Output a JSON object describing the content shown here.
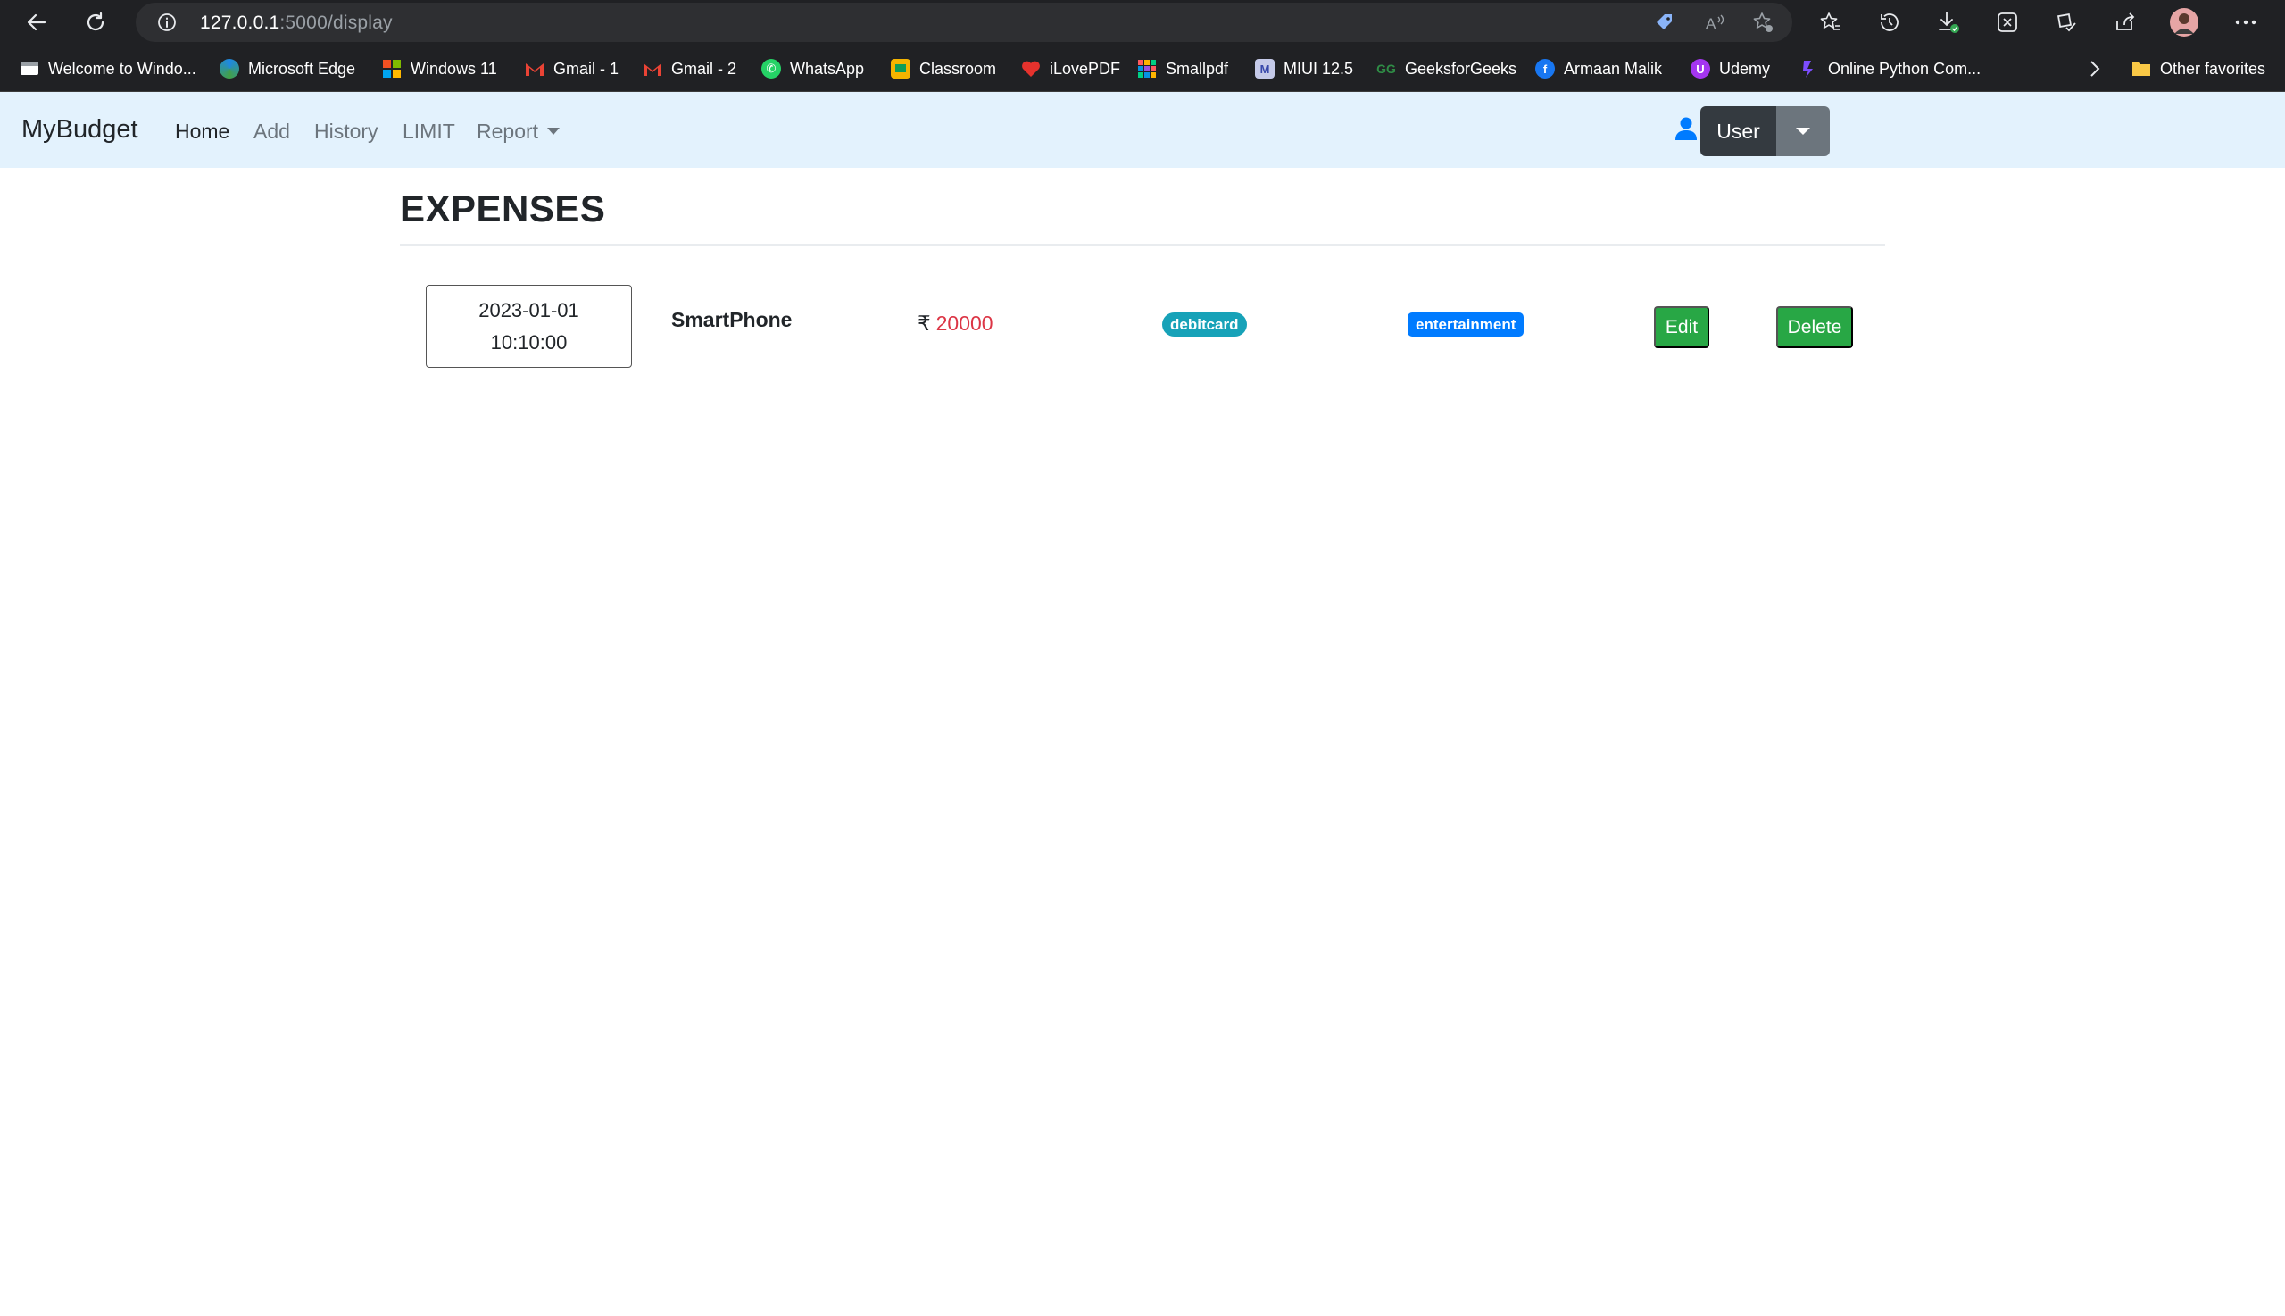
{
  "browser": {
    "url_host": "127.0.0.1",
    "url_path": ":5000/display",
    "bookmarks": [
      {
        "label": "Welcome to Windo...",
        "icon": "windows-welcome-icon",
        "color": "#ffffff"
      },
      {
        "label": "Microsoft Edge",
        "icon": "edge-icon",
        "color": "#1e88e5"
      },
      {
        "label": "Windows 11",
        "icon": "windows-icon",
        "color": "#00a4ef"
      },
      {
        "label": "Gmail - 1",
        "icon": "gmail-icon",
        "color": "#ea4335"
      },
      {
        "label": "Gmail - 2",
        "icon": "gmail-icon",
        "color": "#ea4335"
      },
      {
        "label": "WhatsApp",
        "icon": "whatsapp-icon",
        "color": "#25d366"
      },
      {
        "label": "Classroom",
        "icon": "classroom-icon",
        "color": "#f4b400"
      },
      {
        "label": "iLovePDF",
        "icon": "ilovepdf-icon",
        "color": "#e5322d"
      },
      {
        "label": "Smallpdf",
        "icon": "smallpdf-icon",
        "color": "#ff5a5f"
      },
      {
        "label": "MIUI 12.5",
        "icon": "miui-icon",
        "color": "#8c9eff"
      },
      {
        "label": "GeeksforGeeks",
        "icon": "geeksforgeeks-icon",
        "color": "#2f8d46"
      },
      {
        "label": "Armaan Malik",
        "icon": "facebook-icon",
        "color": "#1877f2"
      },
      {
        "label": "Udemy",
        "icon": "udemy-icon",
        "color": "#a435f0"
      },
      {
        "label": "Online Python Com...",
        "icon": "python-compiler-icon",
        "color": "#7c4dff"
      }
    ],
    "other_favorites": "Other favorites"
  },
  "navbar": {
    "brand": "MyBudget",
    "links": [
      {
        "label": "Home"
      },
      {
        "label": "Add"
      },
      {
        "label": "History"
      },
      {
        "label": "LIMIT"
      },
      {
        "label": "Report"
      }
    ],
    "user_label": "User"
  },
  "main": {
    "title": "EXPENSES",
    "expense": {
      "date": "2023-01-01",
      "time": "10:10:00",
      "name": "SmartPhone",
      "currency": "₹",
      "amount": "20000",
      "payment_mode": "debitcard",
      "category": "entertainment",
      "edit_label": "Edit",
      "delete_label": "Delete"
    }
  },
  "colors": {
    "navbar_bg": "#e3f2fd",
    "amount_red": "#dc3545",
    "badge_info": "#17a2b8",
    "badge_primary": "#007bff",
    "button_success": "#28a745"
  }
}
